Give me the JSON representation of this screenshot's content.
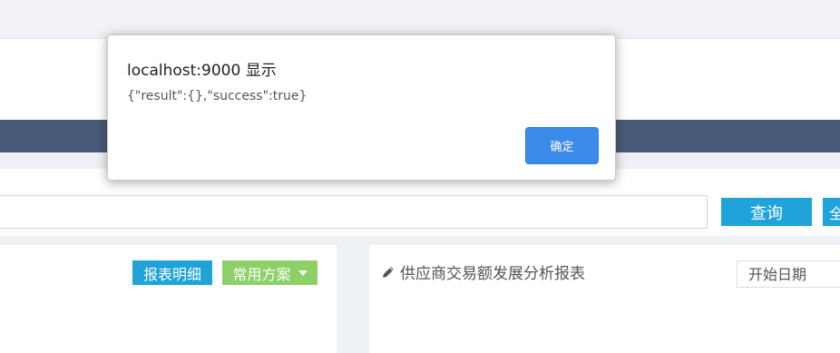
{
  "dialog": {
    "title": "localhost:9000 显示",
    "message": "{\"result\":{},\"success\":true}",
    "ok_label": "确定"
  },
  "toolbar": {
    "search_value": "",
    "query_label": "查询",
    "extra_label": "全"
  },
  "left_panel": {
    "detail_label": "报表明细",
    "scheme_label": "常用方案"
  },
  "right_panel": {
    "title": "供应商交易额发展分析报表",
    "start_date_placeholder": "开始日期"
  },
  "colors": {
    "nav": "#485b76",
    "primary": "#1fa3d9",
    "scheme": "#8dd067",
    "dialog_button": "#3b8cea"
  },
  "icons": {
    "report": "pencil-icon",
    "scheme_dropdown": "caret-down-icon"
  }
}
